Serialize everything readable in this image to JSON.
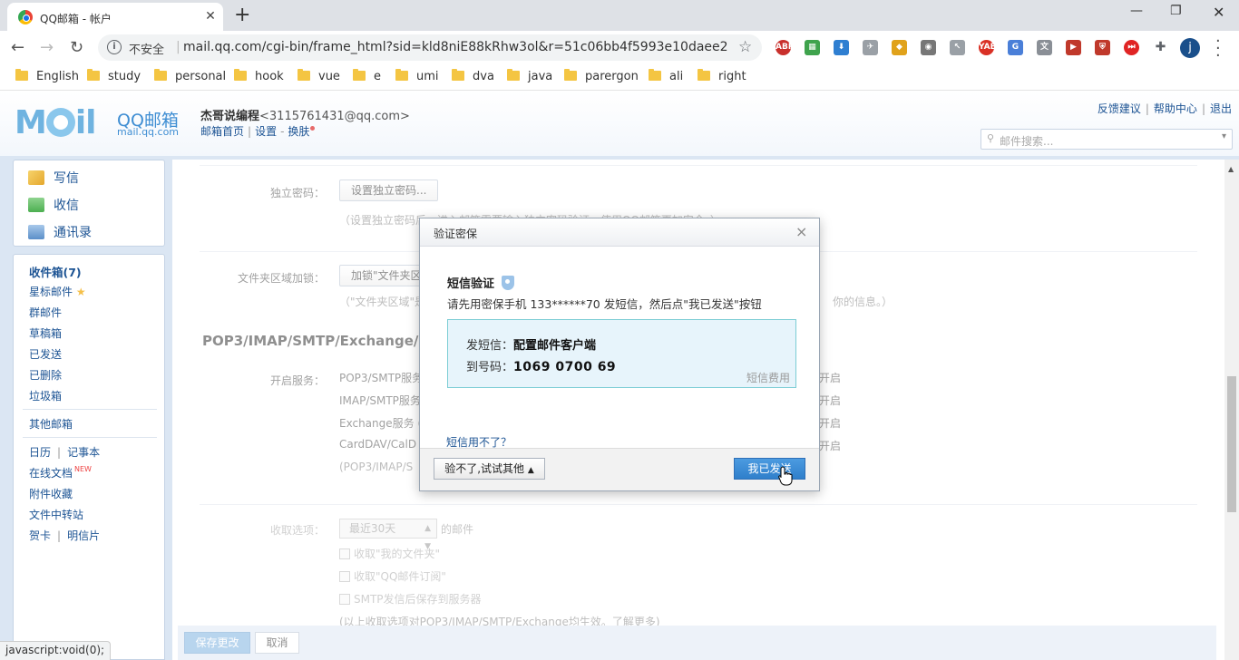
{
  "browser": {
    "tab_title": "QQ邮箱 - 帐户",
    "tab_close": "✕",
    "new_tab": "+",
    "insecure_label": "不安全",
    "url": "mail.qq.com/cgi-bin/frame_html?sid=kld8niE88kRhw3ol&r=51c06bb4f5993e10daee284...",
    "profile_initial": "j",
    "bookmarks": [
      "English",
      "study",
      "personal",
      "hook",
      "vue",
      "e",
      "umi",
      "dva",
      "java",
      "parergon",
      "ali",
      "right"
    ],
    "status_text": "javascript:void(0);"
  },
  "header": {
    "logo_brand": "QQ邮箱",
    "logo_domain": "mail.qq.com",
    "user_name": "杰哥说编程",
    "user_email": "<3115761431@qq.com>",
    "link_home": "邮箱首页",
    "link_settings": "设置",
    "link_skin": "换肤",
    "link_feedback": "反馈建议",
    "link_help": "帮助中心",
    "link_logout": "退出",
    "search_placeholder": "邮件搜索..."
  },
  "sidebar": {
    "compose": "写信",
    "receive": "收信",
    "contacts": "通讯录",
    "inbox": "收件箱(7)",
    "starred": "星标邮件",
    "group": "群邮件",
    "drafts": "草稿箱",
    "sent": "已发送",
    "deleted": "已删除",
    "spam": "垃圾箱",
    "other_mail": "其他邮箱",
    "calendar": "日历",
    "notes": "记事本",
    "online_docs": "在线文档",
    "new_tag": "NEW",
    "attachments": "附件收藏",
    "file_transfer": "文件中转站",
    "cards": "贺卡",
    "postcards": "明信片"
  },
  "settings": {
    "independent_pwd_label": "独立密码：",
    "independent_pwd_btn": "设置独立密码...",
    "independent_pwd_hint": "（设置独立密码后，进入邮箱需要输入独立密码验证，使用QQ邮箱更加安全。）",
    "folder_lock_label": "文件夹区域加锁：",
    "folder_lock_btn": "加锁\"文件夹区",
    "folder_lock_hint": "（\"文件夹区域\"是",
    "folder_lock_hint_tail": "你的信息。）",
    "section_title": "POP3/IMAP/SMTP/Exchange/",
    "service_label": "开启服务：",
    "services": [
      "POP3/SMTP服务",
      "IMAP/SMTP服务",
      "Exchange服务 (",
      "CardDAV/CalD"
    ],
    "service_action": "开启",
    "service_note": "(POP3/IMAP/S",
    "receive_label": "收取选项：",
    "receive_range": "最近30天",
    "receive_suffix": "的邮件",
    "opt_my_folders": "收取\"我的文件夹\"",
    "opt_subscriptions": "收取\"QQ邮件订阅\"",
    "opt_smtp_save": "SMTP发信后保存到服务器",
    "opt_note": "(以上收取选项对POP3/IMAP/SMTP/Exchange均生效。了解更多)",
    "save_btn": "保存更改",
    "cancel_btn": "取消"
  },
  "dialog": {
    "title": "验证密保",
    "close": "×",
    "sms_title": "短信验证",
    "desc": "请先用密保手机 133******70 发短信，然后点\"我已发送\"按钮",
    "send_label": "发短信：",
    "send_value": "配置邮件客户端",
    "to_label": "到号码：",
    "to_value": "1069 0700 69",
    "fee": "短信费用",
    "help_link": "短信用不了？",
    "other_btn": "验不了,试试其他",
    "sent_btn": "我已发送"
  }
}
